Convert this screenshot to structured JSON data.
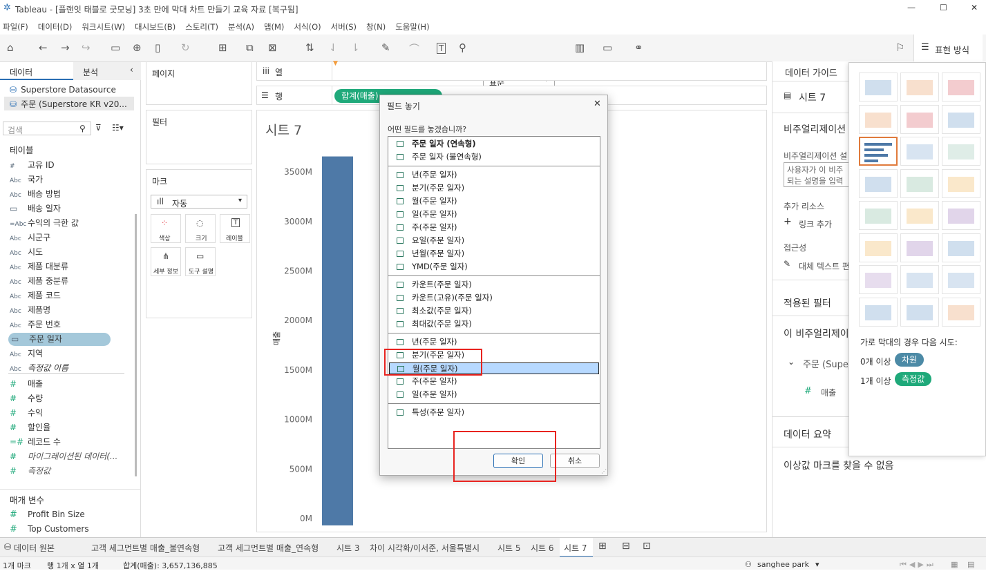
{
  "window": {
    "title": "Tableau - [플랜잇 태블로 굿모닝] 3초 만에 막대 차트 만들기 교육 자료 [복구됨]",
    "min": "—",
    "max": "☐",
    "close": "✕"
  },
  "menu": [
    "파일(F)",
    "데이터(D)",
    "워크시트(W)",
    "대시보드(B)",
    "스토리(T)",
    "분석(A)",
    "맵(M)",
    "서식(O)",
    "서버(S)",
    "창(N)",
    "도움말(H)"
  ],
  "toolbar": {
    "fit": "표준",
    "present_label": "표현 방식"
  },
  "left": {
    "tab_data": "데이터",
    "tab_analysis": "분석",
    "sources": [
      "Superstore Datasource",
      "주문 (Superstore KR v20..."
    ],
    "search_placeholder": "검색",
    "tables_header": "테이블",
    "fields": [
      {
        "t": "#",
        "n": "고유 ID"
      },
      {
        "t": "Abc",
        "n": "국가"
      },
      {
        "t": "Abc",
        "n": "배송 방법"
      },
      {
        "t": "cal",
        "n": "배송 일자"
      },
      {
        "t": "=Abc",
        "n": "수익의 극한 값"
      },
      {
        "t": "Abc",
        "n": "시군구"
      },
      {
        "t": "Abc",
        "n": "시도"
      },
      {
        "t": "Abc",
        "n": "제품 대분류"
      },
      {
        "t": "Abc",
        "n": "제품 중분류"
      },
      {
        "t": "Abc",
        "n": "제품 코드"
      },
      {
        "t": "Abc",
        "n": "제품명"
      },
      {
        "t": "Abc",
        "n": "주문 번호"
      },
      {
        "t": "cal",
        "n": "주문 일자"
      },
      {
        "t": "Abc",
        "n": "지역"
      },
      {
        "t": "Abc",
        "n": "측정값 이름"
      }
    ],
    "measures": [
      {
        "t": "#",
        "n": "매출"
      },
      {
        "t": "#",
        "n": "수량"
      },
      {
        "t": "#",
        "n": "수익"
      },
      {
        "t": "#",
        "n": "할인율"
      },
      {
        "t": "=#",
        "n": "레코드 수"
      },
      {
        "t": "#",
        "n": "마이그레이션된 데이터(..."
      },
      {
        "t": "#",
        "n": "측정값"
      }
    ],
    "params_header": "매개 변수",
    "params": [
      "Profit Bin Size",
      "Top Customers"
    ]
  },
  "cards": {
    "pages": "페이지",
    "filters": "필터",
    "marks": "마크",
    "mark_type": "자동",
    "buttons": [
      "색상",
      "크기",
      "레이블",
      "세부 정보",
      "도구 설명"
    ]
  },
  "shelves": {
    "columns": "열",
    "rows": "행",
    "rows_pill": "합계(매출)"
  },
  "sheet": {
    "title": "시트 7",
    "yaxis": "매출"
  },
  "chart_data": {
    "type": "bar",
    "categories": [
      ""
    ],
    "values": [
      3657136885
    ],
    "ylabel": "매출",
    "ylim": [
      0,
      3800000000
    ],
    "yticks": [
      "0M",
      "500M",
      "1000M",
      "1500M",
      "2000M",
      "2500M",
      "3000M",
      "3500M"
    ]
  },
  "dialog": {
    "title": "필드 놓기",
    "question": "어떤 필드를 놓겠습니까?",
    "ok": "확인",
    "cancel": "취소",
    "groups": [
      [
        "주문 일자 (연속형)",
        "주문 일자 (불연속형)"
      ],
      [
        "년(주문 일자)",
        "분기(주문 일자)",
        "월(주문 일자)",
        "일(주문 일자)",
        "주(주문 일자)",
        "요일(주문 일자)",
        "년월(주문 일자)",
        "YMD(주문 일자)"
      ],
      [
        "카운트(주문 일자)",
        "카운트(고유)(주문 일자)",
        "최소값(주문 일자)",
        "최대값(주문 일자)"
      ],
      [
        "년(주문 일자)",
        "분기(주문 일자)",
        "월(주문 일자)",
        "주(주문 일자)",
        "일(주문 일자)"
      ],
      [
        "특성(주문 일자)"
      ]
    ],
    "selected": "월(주문 일자)"
  },
  "guide": {
    "header": "데이터 가이드",
    "sheet": "시트 7",
    "viz_desc": "비주얼리제이션 설명",
    "viz_desc_label": "비주얼리제이션 설",
    "placeholder": "사용자가 이 비주\n되는 설명을 입력",
    "resources": "추가 리소스",
    "add_link": "링크 추가",
    "access": "접근성",
    "alt_text": "대체 텍스트 편",
    "applied": "적용된 필터",
    "this_viz": "이 비주얼리제이",
    "src": "주문 (Supe",
    "measure": "매출",
    "summary": "데이터 요약",
    "outlier": "이상값 마크를 찾을 수 없음"
  },
  "showme": {
    "hint": "가로 막대의 경우 다음 시도:",
    "dim_label": "0개 이상",
    "dim": "차원",
    "mea_label": "1개 이상",
    "mea": "측정값",
    "dim_color": "#4c8aa6",
    "mea_color": "#1fa97a"
  },
  "tabs": [
    "데이터 원본",
    "고객 세그먼트별 매출_불연속형",
    "고객 세그먼트별 매출_연속형",
    "시트 3",
    "차이 시각화/이서준, 서울특별시",
    "시트 5",
    "시트 6",
    "시트 7"
  ],
  "status": {
    "marks": "1개 마크",
    "rows": "행 1개  x  열 1개",
    "sum": "합계(매출): 3,657,136,885",
    "user": "sanghee park"
  },
  "colors": {
    "bar": "#4e79a7",
    "pill": "#1fa97a",
    "highlight": "#b7d9ff",
    "red": "#e8231f"
  }
}
